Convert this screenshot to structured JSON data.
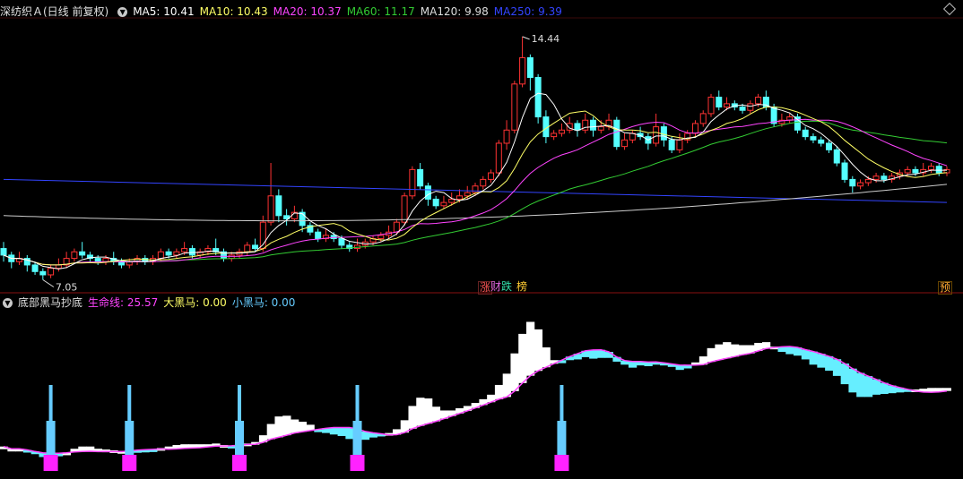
{
  "main_panel": {
    "title": "深纺织Ａ(日线 前复权)",
    "indicators": [
      {
        "label": "MA5: 10.41",
        "color": "#ffffff"
      },
      {
        "label": "MA10: 10.43",
        "color": "#ffff66"
      },
      {
        "label": "MA20: 10.37",
        "color": "#ff44ff"
      },
      {
        "label": "MA60: 11.17",
        "color": "#33cc33"
      },
      {
        "label": "MA120: 9.98",
        "color": "#dddddd"
      },
      {
        "label": "MA250: 9.39",
        "color": "#3344ff"
      }
    ],
    "high_label": "14.44",
    "low_label": "7.05",
    "badges": [
      {
        "text": "涨",
        "color": "#ff5555"
      },
      {
        "text": "财",
        "color": "#dd66dd"
      },
      {
        "text": "跌",
        "color": "#33ddaa"
      },
      {
        "text": "榜",
        "color": "#ffcc33"
      },
      {
        "text": "预",
        "color": "#ffaa33"
      }
    ]
  },
  "sub_panel": {
    "title": "底部黑马抄底",
    "indicators": [
      {
        "label": "生命线: 25.57",
        "color": "#ff44ff"
      },
      {
        "label": "大黑马: 0.00",
        "color": "#ffff66"
      },
      {
        "label": "小黑马: 0.00",
        "color": "#66ccff"
      }
    ]
  },
  "chart_data": {
    "type": "candlestick",
    "price_range": [
      6.9,
      14.9
    ],
    "candles": [
      [
        8.0,
        7.8,
        8.2,
        7.6
      ],
      [
        7.8,
        7.6,
        7.9,
        7.4
      ],
      [
        7.6,
        7.7,
        7.9,
        7.5
      ],
      [
        7.7,
        7.5,
        7.8,
        7.3
      ],
      [
        7.5,
        7.3,
        7.6,
        7.2
      ],
      [
        7.3,
        7.2,
        7.4,
        7.05
      ],
      [
        7.2,
        7.4,
        7.5,
        7.1
      ],
      [
        7.4,
        7.5,
        7.7,
        7.3
      ],
      [
        7.5,
        7.7,
        7.9,
        7.4
      ],
      [
        7.7,
        7.9,
        8.0,
        7.6
      ],
      [
        7.9,
        7.8,
        8.2,
        7.7
      ],
      [
        7.8,
        7.7,
        7.9,
        7.6
      ],
      [
        7.7,
        7.6,
        7.8,
        7.5
      ],
      [
        7.6,
        7.7,
        7.8,
        7.5
      ],
      [
        7.7,
        7.6,
        7.9,
        7.5
      ],
      [
        7.6,
        7.5,
        7.7,
        7.4
      ],
      [
        7.5,
        7.6,
        7.7,
        7.4
      ],
      [
        7.6,
        7.7,
        7.8,
        7.5
      ],
      [
        7.7,
        7.6,
        7.8,
        7.5
      ],
      [
        7.6,
        7.7,
        7.8,
        7.5
      ],
      [
        7.7,
        7.9,
        8.0,
        7.6
      ],
      [
        7.9,
        7.8,
        8.0,
        7.7
      ],
      [
        7.8,
        7.9,
        8.0,
        7.7
      ],
      [
        7.9,
        8.0,
        8.2,
        7.8
      ],
      [
        8.0,
        7.8,
        8.1,
        7.7
      ],
      [
        7.8,
        7.9,
        8.0,
        7.7
      ],
      [
        7.9,
        8.0,
        8.1,
        7.8
      ],
      [
        8.0,
        7.9,
        8.3,
        7.8
      ],
      [
        7.9,
        7.7,
        8.0,
        7.6
      ],
      [
        7.7,
        7.8,
        7.9,
        7.6
      ],
      [
        7.8,
        7.9,
        8.0,
        7.7
      ],
      [
        7.9,
        8.1,
        8.2,
        7.8
      ],
      [
        8.1,
        8.0,
        8.3,
        7.9
      ],
      [
        8.0,
        8.8,
        9.0,
        7.9
      ],
      [
        8.8,
        9.6,
        10.6,
        8.7
      ],
      [
        9.6,
        9.0,
        9.8,
        8.8
      ],
      [
        9.0,
        8.9,
        9.2,
        8.7
      ],
      [
        8.9,
        9.1,
        9.3,
        8.8
      ],
      [
        9.1,
        8.7,
        9.2,
        8.5
      ],
      [
        8.7,
        8.5,
        8.8,
        8.4
      ],
      [
        8.5,
        8.3,
        8.6,
        8.2
      ],
      [
        8.3,
        8.4,
        8.6,
        8.2
      ],
      [
        8.4,
        8.3,
        8.5,
        8.2
      ],
      [
        8.3,
        8.1,
        8.4,
        8.0
      ],
      [
        8.1,
        8.0,
        8.2,
        7.9
      ],
      [
        8.0,
        8.1,
        8.3,
        7.9
      ],
      [
        8.1,
        8.2,
        8.3,
        8.0
      ],
      [
        8.2,
        8.3,
        8.4,
        8.1
      ],
      [
        8.3,
        8.4,
        8.5,
        8.2
      ],
      [
        8.4,
        8.5,
        8.7,
        8.3
      ],
      [
        8.5,
        8.8,
        8.9,
        8.4
      ],
      [
        8.8,
        9.6,
        9.7,
        8.7
      ],
      [
        9.6,
        10.4,
        10.5,
        9.5
      ],
      [
        10.4,
        9.9,
        10.6,
        9.8
      ],
      [
        9.9,
        9.5,
        10.0,
        9.3
      ],
      [
        9.5,
        9.3,
        9.6,
        9.2
      ],
      [
        9.3,
        9.4,
        9.6,
        9.2
      ],
      [
        9.4,
        9.5,
        9.7,
        9.3
      ],
      [
        9.5,
        9.6,
        9.8,
        9.4
      ],
      [
        9.6,
        9.7,
        9.9,
        9.5
      ],
      [
        9.7,
        9.9,
        10.0,
        9.6
      ],
      [
        9.9,
        10.1,
        10.2,
        9.8
      ],
      [
        10.1,
        10.3,
        10.4,
        10.0
      ],
      [
        10.3,
        11.2,
        11.3,
        10.2
      ],
      [
        11.2,
        11.6,
        11.9,
        11.0
      ],
      [
        11.6,
        13.0,
        13.1,
        11.5
      ],
      [
        13.0,
        13.8,
        14.44,
        12.9
      ],
      [
        13.8,
        13.2,
        13.9,
        12.8
      ],
      [
        13.2,
        12.0,
        13.3,
        11.8
      ],
      [
        12.0,
        11.4,
        12.2,
        11.2
      ],
      [
        11.4,
        11.5,
        11.6,
        11.3
      ],
      [
        11.5,
        11.6,
        11.8,
        11.4
      ],
      [
        11.6,
        11.8,
        12.0,
        11.5
      ],
      [
        11.8,
        11.6,
        11.9,
        11.4
      ],
      [
        11.6,
        11.9,
        12.1,
        11.5
      ],
      [
        11.9,
        11.6,
        12.0,
        11.4
      ],
      [
        11.6,
        11.7,
        11.9,
        11.5
      ],
      [
        11.7,
        11.9,
        12.1,
        11.6
      ],
      [
        11.9,
        11.1,
        12.0,
        11.0
      ],
      [
        11.1,
        11.3,
        11.5,
        11.0
      ],
      [
        11.3,
        11.5,
        11.6,
        11.2
      ],
      [
        11.5,
        11.4,
        11.7,
        11.3
      ],
      [
        11.4,
        11.2,
        11.5,
        11.0
      ],
      [
        11.2,
        11.7,
        12.1,
        11.1
      ],
      [
        11.7,
        11.3,
        11.8,
        11.1
      ],
      [
        11.3,
        11.0,
        11.4,
        10.9
      ],
      [
        11.0,
        11.3,
        11.5,
        10.9
      ],
      [
        11.3,
        11.5,
        11.6,
        11.2
      ],
      [
        11.5,
        11.8,
        11.9,
        11.4
      ],
      [
        11.8,
        12.1,
        12.2,
        11.7
      ],
      [
        12.1,
        12.6,
        12.7,
        12.0
      ],
      [
        12.6,
        12.3,
        12.8,
        12.2
      ],
      [
        12.3,
        12.4,
        12.6,
        12.2
      ],
      [
        12.4,
        12.3,
        12.5,
        12.2
      ],
      [
        12.3,
        12.2,
        12.4,
        12.1
      ],
      [
        12.2,
        12.4,
        12.5,
        12.1
      ],
      [
        12.4,
        12.6,
        12.7,
        12.3
      ],
      [
        12.6,
        12.3,
        12.8,
        12.2
      ],
      [
        12.3,
        11.8,
        12.4,
        11.7
      ],
      [
        11.8,
        11.9,
        12.1,
        11.7
      ],
      [
        11.9,
        12.0,
        12.1,
        11.8
      ],
      [
        12.0,
        11.6,
        12.1,
        11.5
      ],
      [
        11.6,
        11.4,
        11.7,
        11.3
      ],
      [
        11.4,
        11.3,
        11.5,
        11.2
      ],
      [
        11.3,
        11.2,
        11.4,
        11.1
      ],
      [
        11.2,
        11.0,
        11.3,
        10.9
      ],
      [
        11.0,
        10.6,
        11.1,
        10.5
      ],
      [
        10.6,
        10.1,
        10.7,
        10.0
      ],
      [
        10.1,
        9.9,
        10.2,
        9.7
      ],
      [
        9.9,
        10.0,
        10.1,
        9.8
      ],
      [
        10.0,
        10.1,
        10.2,
        9.9
      ],
      [
        10.1,
        10.2,
        10.3,
        10.0
      ],
      [
        10.2,
        10.1,
        10.3,
        10.0
      ],
      [
        10.1,
        10.2,
        10.3,
        10.0
      ],
      [
        10.2,
        10.3,
        10.4,
        10.1
      ],
      [
        10.3,
        10.4,
        10.5,
        10.2
      ],
      [
        10.4,
        10.3,
        10.5,
        10.2
      ],
      [
        10.3,
        10.4,
        10.6,
        10.2
      ],
      [
        10.4,
        10.5,
        10.6,
        10.3
      ],
      [
        10.5,
        10.3,
        10.6,
        10.2
      ],
      [
        10.3,
        10.4,
        10.5,
        10.2
      ]
    ],
    "ma250": [
      10.1,
      9.4
    ],
    "ma120": [
      9.0,
      9.95
    ],
    "ma60": [
      7.75,
      11.17
    ],
    "ma20_end": 10.37,
    "ma10_end": 10.43,
    "ma5_end": 10.41,
    "sub_range": [
      0,
      40
    ],
    "life_line_end": 25.57,
    "bottom_signals": [
      0.09,
      0.42,
      1.15,
      2.0,
      5.5,
      6.5
    ]
  }
}
